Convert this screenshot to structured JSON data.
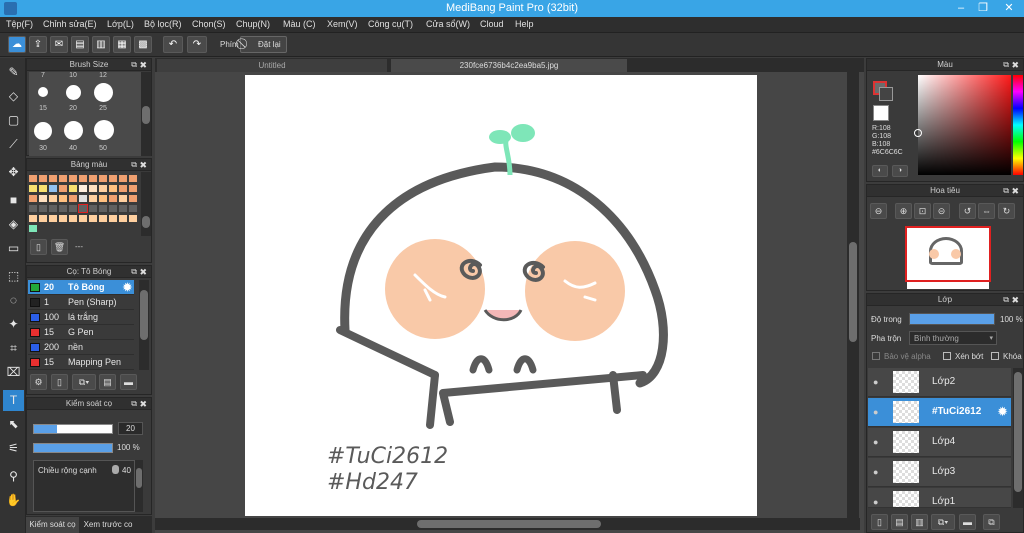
{
  "window": {
    "title": "MediBang Paint Pro (32bit)",
    "min": "–",
    "max": "❐",
    "close": "✕"
  },
  "menu": [
    "Tệp(F)",
    "Chỉnh sửa(E)",
    "Lớp(L)",
    "Bộ lọc(R)",
    "Chọn(S)",
    "Chụp(N)",
    "Màu (C)",
    "Xem(V)",
    "Công cụ(T)",
    "Cửa sổ(W)",
    "Cloud",
    "Help"
  ],
  "toolbar": {
    "undo": "↶",
    "redo": "↷",
    "key_label": "Phím",
    "reset_label": "Đặt lại"
  },
  "tabs": {
    "untitled": "Untitled",
    "file": "230fce6736b4c2ea9ba5.jpg"
  },
  "brush_size": {
    "title": "Brush Size",
    "labels": [
      "7",
      "10",
      "12",
      "15",
      "20",
      "25",
      "30",
      "40",
      "50"
    ]
  },
  "palette": {
    "title": "Bảng màu",
    "footer_text": "---"
  },
  "brush_list": {
    "title": "Cọ: Tô Bóng",
    "items": [
      {
        "size": "20",
        "name": "Tô Bóng",
        "color": "#22a83a"
      },
      {
        "size": "1",
        "name": "Pen (Sharp)",
        "color": "#222222"
      },
      {
        "size": "100",
        "name": "lá trắng",
        "color": "#2b5ee8"
      },
      {
        "size": "15",
        "name": "G Pen",
        "color": "#e83030"
      },
      {
        "size": "200",
        "name": "nền",
        "color": "#2b5ee8"
      },
      {
        "size": "15",
        "name": "Mapping Pen",
        "color": "#e83030"
      }
    ]
  },
  "brush_control": {
    "title": "Kiểm soát cọ",
    "size_value": "20",
    "size_fill": 0.3,
    "opacity_value": "100 %",
    "opacity_fill": 1.0,
    "edge_label": "Chiều rộng cạnh",
    "edge_value": "40"
  },
  "bottom_tabs": {
    "control": "Kiểm soát cọ",
    "preview": "Xem trước co"
  },
  "color_panel": {
    "title": "Màu",
    "r": "R:108",
    "g": "G:108",
    "b": "B:108",
    "hex": "#6C6C6C",
    "current": "#6C6C6C"
  },
  "navigator": {
    "title": "Hoa tiêu"
  },
  "layer_panel": {
    "title": "Lớp",
    "opacity_label": "Độ trong",
    "opacity_value": "100 %",
    "opacity_fill": 1.0,
    "blend_label": "Pha trộn",
    "blend_value": "Bình thường",
    "protect_alpha": "Bảo vệ alpha",
    "clip": "Xén bớt",
    "lock": "Khóa",
    "layers": [
      "Lớp2",
      "#TuCi2612",
      "Lớp4",
      "Lớp3",
      "Lớp1"
    ]
  },
  "canvas": {
    "line1": "#TuCi2612",
    "line2": "#Hd247"
  },
  "colors": {
    "accent": "#3b8fd8",
    "titlebar": "#39a5e6",
    "stroke": "#5a5a5a",
    "cheek": "#f9c9a8",
    "sprout": "#7ee6b8"
  }
}
